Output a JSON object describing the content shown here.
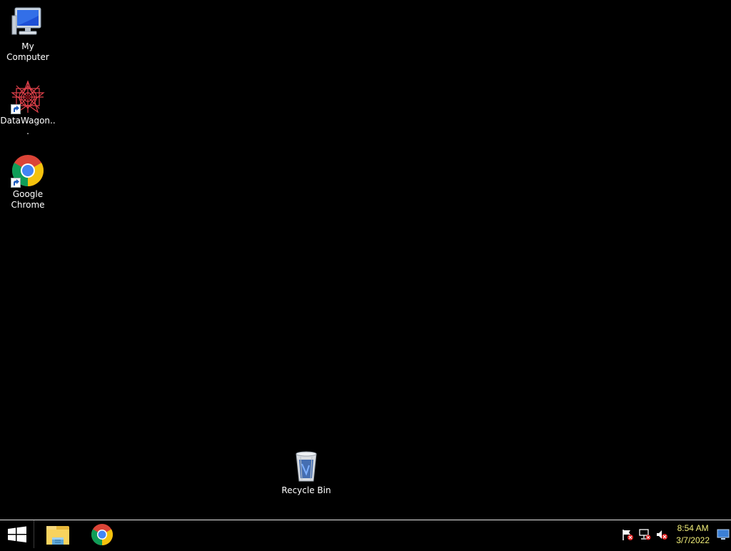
{
  "desktop": {
    "icons": [
      {
        "label": "My Computer",
        "icon": "computer-icon"
      },
      {
        "label": "DataWagon...",
        "icon": "datawagon-icon"
      },
      {
        "label": "Google Chrome",
        "icon": "chrome-icon"
      },
      {
        "label": "Recycle Bin",
        "icon": "recycle-bin-icon"
      }
    ]
  },
  "taskbar": {
    "start_icon": "windows-logo-icon",
    "pinned": [
      {
        "icon": "file-explorer-icon"
      },
      {
        "icon": "chrome-icon"
      }
    ],
    "tray": {
      "icons": [
        "action-center-flag-icon",
        "network-icon",
        "volume-muted-icon"
      ],
      "time": "8:54 AM",
      "date": "3/7/2022"
    },
    "show_desktop_icon": "show-desktop-icon"
  },
  "colors": {
    "background": "#000000",
    "clock_text": "#f3f07a",
    "taskbar_border": "#e8e8e8"
  }
}
